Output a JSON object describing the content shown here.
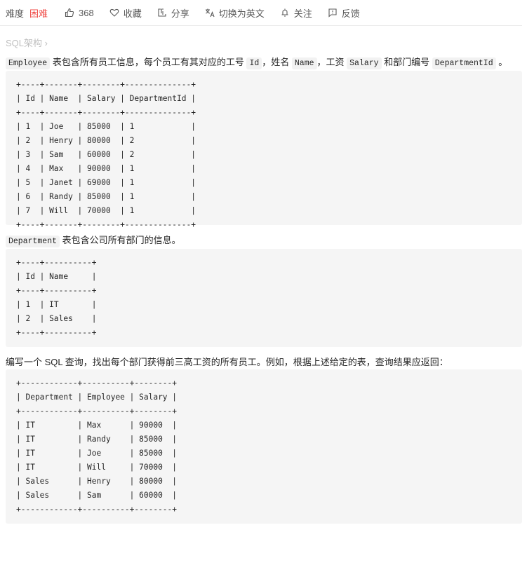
{
  "toolbar": {
    "difficulty_label": "难度",
    "difficulty_value": "困难",
    "difficulty_color": "#ef4743",
    "likes": "368",
    "favorite_label": "收藏",
    "share_label": "分享",
    "switch_lang_label": "切换为英文",
    "follow_label": "关注",
    "feedback_label": "反馈"
  },
  "breadcrumb": {
    "label": "SQL架构",
    "chevron": "›"
  },
  "content": {
    "p1": {
      "code_employee": "Employee",
      "text_a": " 表包含所有员工信息，每个员工有其对应的工号 ",
      "code_id": "Id",
      "text_b": "，姓名 ",
      "code_name": "Name",
      "text_c": "，工资 ",
      "code_salary": "Salary",
      "text_d": " 和部门编号 ",
      "code_dept": "DepartmentId",
      "text_e": " 。"
    },
    "employee_table": {
      "headers": [
        "Id",
        "Name",
        "Salary",
        "DepartmentId"
      ],
      "rows": [
        [
          "1",
          "Joe",
          "85000",
          "1"
        ],
        [
          "2",
          "Henry",
          "80000",
          "2"
        ],
        [
          "3",
          "Sam",
          "60000",
          "2"
        ],
        [
          "4",
          "Max",
          "90000",
          "1"
        ],
        [
          "5",
          "Janet",
          "69000",
          "1"
        ],
        [
          "6",
          "Randy",
          "85000",
          "1"
        ],
        [
          "7",
          "Will",
          "70000",
          "1"
        ]
      ],
      "widths": [
        2,
        5,
        6,
        12
      ]
    },
    "p2": {
      "code_department": "Department",
      "text": " 表包含公司所有部门的信息。"
    },
    "department_table": {
      "headers": [
        "Id",
        "Name"
      ],
      "rows": [
        [
          "1",
          "IT"
        ],
        [
          "2",
          "Sales"
        ]
      ],
      "widths": [
        2,
        8
      ]
    },
    "p3": {
      "text": "编写一个 SQL 查询，找出每个部门获得前三高工资的所有员工。例如，根据上述给定的表，查询结果应返回："
    },
    "result_table": {
      "headers": [
        "Department",
        "Employee",
        "Salary"
      ],
      "rows": [
        [
          "IT",
          "Max",
          "90000"
        ],
        [
          "IT",
          "Randy",
          "85000"
        ],
        [
          "IT",
          "Joe",
          "85000"
        ],
        [
          "IT",
          "Will",
          "70000"
        ],
        [
          "Sales",
          "Henry",
          "80000"
        ],
        [
          "Sales",
          "Sam",
          "60000"
        ]
      ],
      "widths": [
        10,
        8,
        6
      ]
    }
  }
}
